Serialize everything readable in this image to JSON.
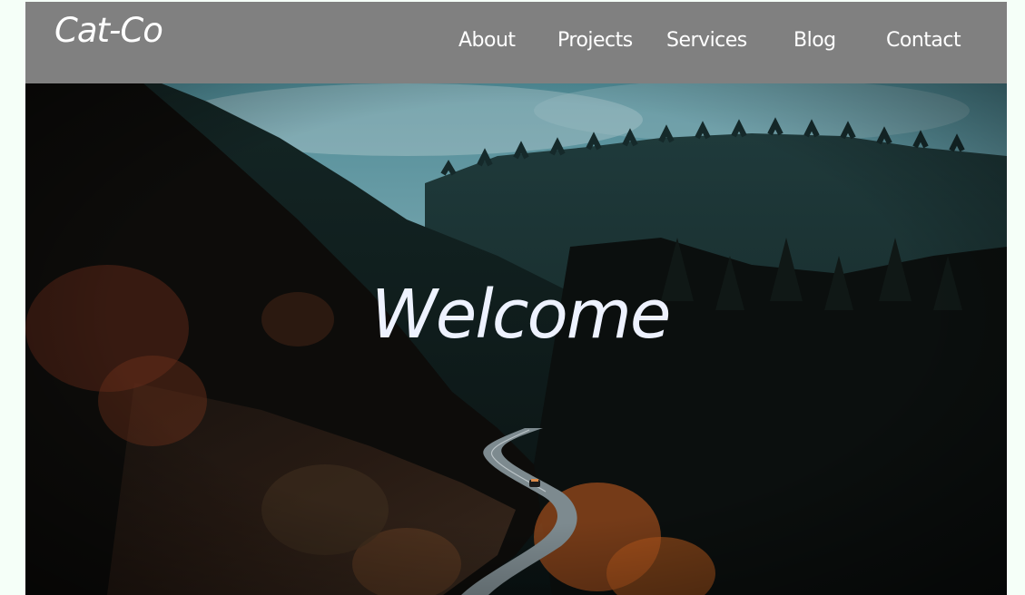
{
  "brand": {
    "name": "Cat-Co"
  },
  "nav": {
    "items": [
      {
        "label": "About"
      },
      {
        "label": "Projects"
      },
      {
        "label": "Services"
      },
      {
        "label": "Blog"
      },
      {
        "label": "Contact"
      }
    ]
  },
  "hero": {
    "title": "Welcome",
    "image": "forest-road-photo"
  },
  "colors": {
    "navbar_bg": "#808080",
    "nav_text": "#ffffff",
    "hero_text": "#eef2ff",
    "page_bg": "#f5fff8"
  }
}
